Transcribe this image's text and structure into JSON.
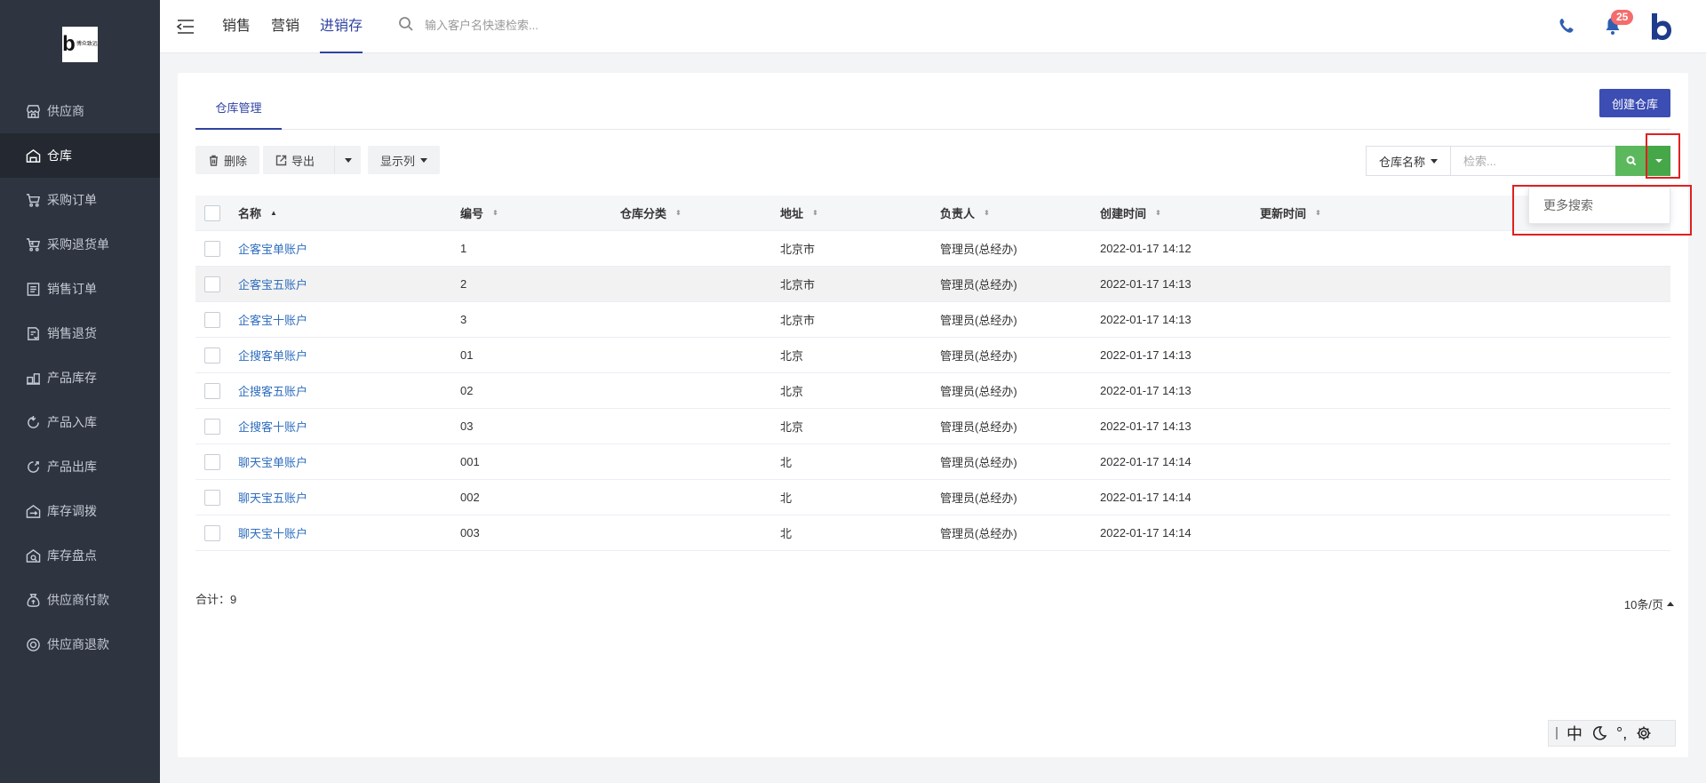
{
  "brand": {
    "logo_text": "博众致远"
  },
  "sidebar": {
    "items": [
      {
        "label": "供应商",
        "icon": "store-icon"
      },
      {
        "label": "仓库",
        "icon": "warehouse-icon",
        "active": true
      },
      {
        "label": "采购订单",
        "icon": "cart-icon"
      },
      {
        "label": "采购退货单",
        "icon": "cart-return-icon"
      },
      {
        "label": "销售订单",
        "icon": "list-icon"
      },
      {
        "label": "销售退货",
        "icon": "return-doc-icon"
      },
      {
        "label": "产品库存",
        "icon": "inventory-icon"
      },
      {
        "label": "产品入库",
        "icon": "stock-in-icon"
      },
      {
        "label": "产品出库",
        "icon": "stock-out-icon"
      },
      {
        "label": "库存调拨",
        "icon": "transfer-icon"
      },
      {
        "label": "库存盘点",
        "icon": "stocktake-icon"
      },
      {
        "label": "供应商付款",
        "icon": "money-bag-icon"
      },
      {
        "label": "供应商退款",
        "icon": "refund-icon"
      }
    ]
  },
  "topbar": {
    "tabs": [
      "销售",
      "营销",
      "进销存"
    ],
    "active_tab": "进销存",
    "search_placeholder": "输入客户名快速检索...",
    "notification_count": "25"
  },
  "main": {
    "tab_label": "仓库管理",
    "create_button": "创建仓库",
    "toolbar": {
      "delete": "删除",
      "export": "导出",
      "columns": "显示列"
    },
    "search": {
      "field": "仓库名称",
      "placeholder": "检索...",
      "more_search": "更多搜索"
    },
    "table": {
      "headers": [
        "名称",
        "编号",
        "仓库分类",
        "地址",
        "负责人",
        "创建时间",
        "更新时间"
      ],
      "rows": [
        {
          "name": "企客宝单账户",
          "no": "1",
          "category": "",
          "address": "北京市",
          "manager": "管理员(总经办)",
          "created": "2022-01-17 14:12",
          "updated": ""
        },
        {
          "name": "企客宝五账户",
          "no": "2",
          "category": "",
          "address": "北京市",
          "manager": "管理员(总经办)",
          "created": "2022-01-17 14:13",
          "updated": ""
        },
        {
          "name": "企客宝十账户",
          "no": "3",
          "category": "",
          "address": "北京市",
          "manager": "管理员(总经办)",
          "created": "2022-01-17 14:13",
          "updated": ""
        },
        {
          "name": "企搜客单账户",
          "no": "01",
          "category": "",
          "address": "北京",
          "manager": "管理员(总经办)",
          "created": "2022-01-17 14:13",
          "updated": ""
        },
        {
          "name": "企搜客五账户",
          "no": "02",
          "category": "",
          "address": "北京",
          "manager": "管理员(总经办)",
          "created": "2022-01-17 14:13",
          "updated": ""
        },
        {
          "name": "企搜客十账户",
          "no": "03",
          "category": "",
          "address": "北京",
          "manager": "管理员(总经办)",
          "created": "2022-01-17 14:13",
          "updated": ""
        },
        {
          "name": "聊天宝单账户",
          "no": "001",
          "category": "",
          "address": "北",
          "manager": "管理员(总经办)",
          "created": "2022-01-17 14:14",
          "updated": ""
        },
        {
          "name": "聊天宝五账户",
          "no": "002",
          "category": "",
          "address": "北",
          "manager": "管理员(总经办)",
          "created": "2022-01-17 14:14",
          "updated": ""
        },
        {
          "name": "聊天宝十账户",
          "no": "003",
          "category": "",
          "address": "北",
          "manager": "管理员(总经办)",
          "created": "2022-01-17 14:14",
          "updated": ""
        }
      ]
    },
    "total_label": "合计：9",
    "page_size": "10条/页"
  },
  "ime": {
    "lang": "中",
    "punct": "°,"
  },
  "colors": {
    "accent": "#2f43a2",
    "sidebar_bg": "#2e3440",
    "search_green": "#5cb85c",
    "link": "#2f6ebf",
    "highlight": "#e02020"
  }
}
